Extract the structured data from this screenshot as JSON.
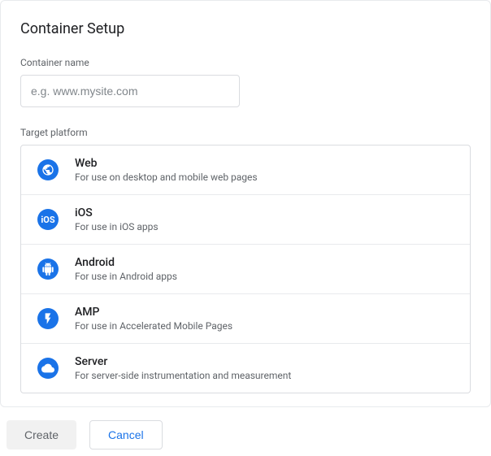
{
  "panel": {
    "title": "Container Setup",
    "container_name_label": "Container name",
    "container_name_placeholder": "e.g. www.mysite.com",
    "target_platform_label": "Target platform"
  },
  "platforms": [
    {
      "title": "Web",
      "desc": "For use on desktop and mobile web pages"
    },
    {
      "title": "iOS",
      "desc": "For use in iOS apps"
    },
    {
      "title": "Android",
      "desc": "For use in Android apps"
    },
    {
      "title": "AMP",
      "desc": "For use in Accelerated Mobile Pages"
    },
    {
      "title": "Server",
      "desc": "For server-side instrumentation and measurement"
    }
  ],
  "buttons": {
    "create": "Create",
    "cancel": "Cancel"
  }
}
